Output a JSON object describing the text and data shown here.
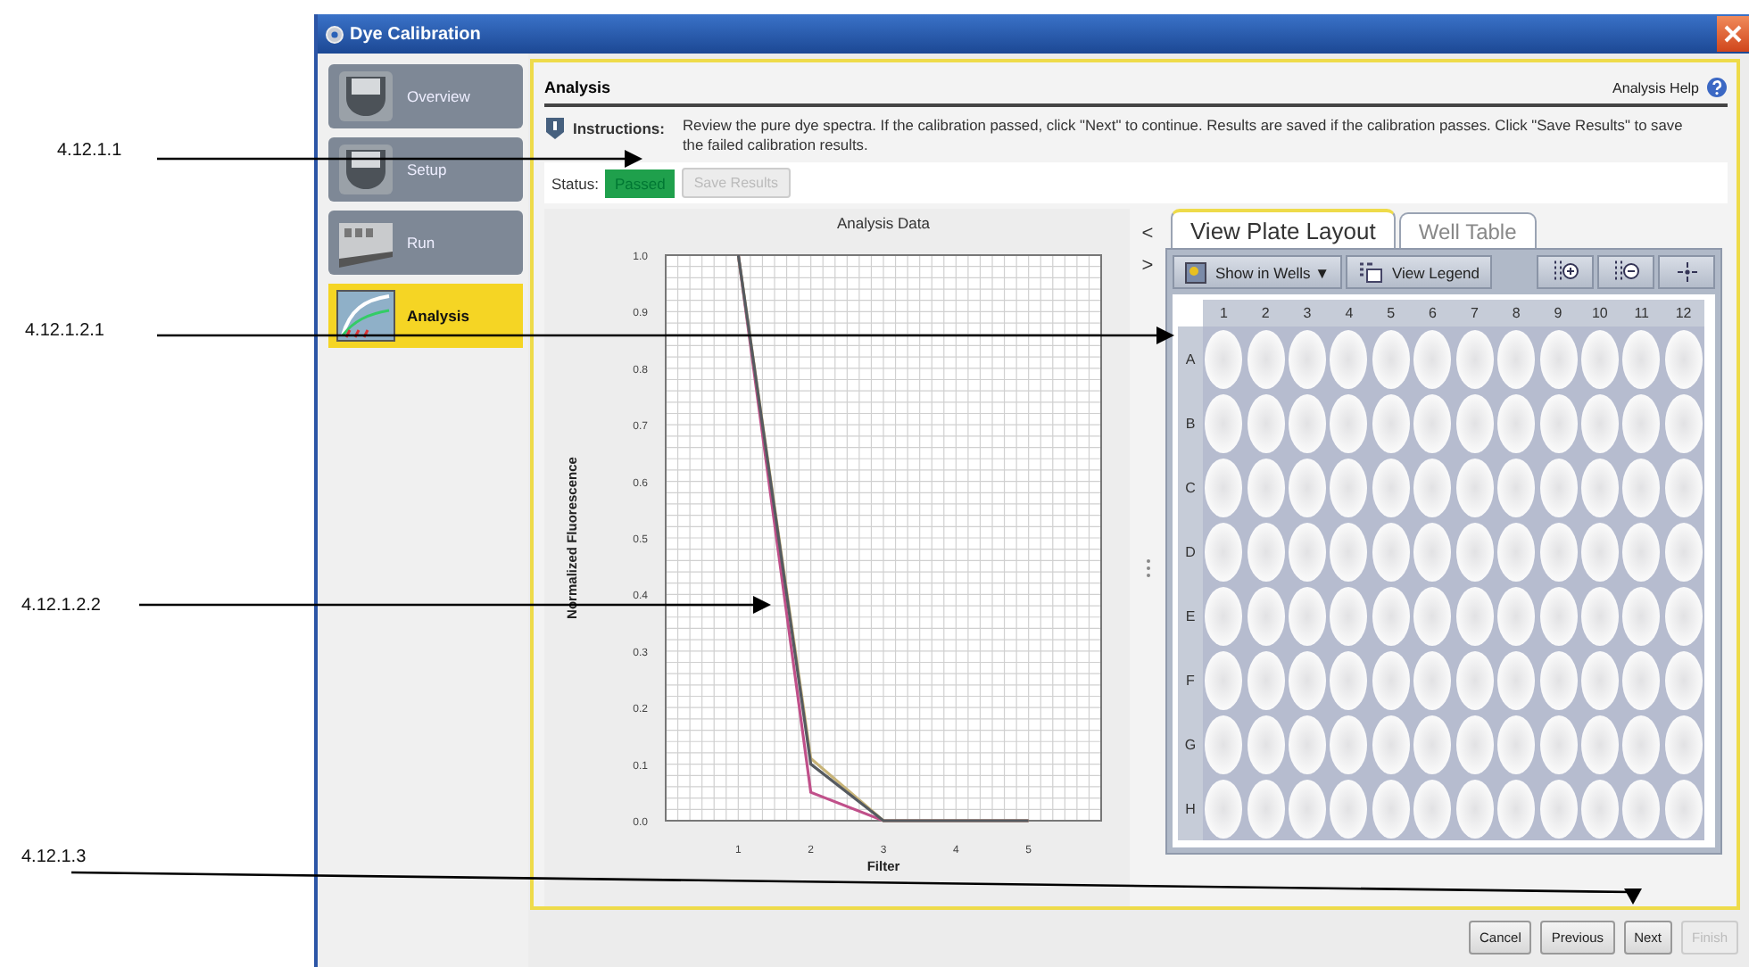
{
  "window": {
    "title": "Dye Calibration"
  },
  "sidebar": {
    "items": [
      {
        "label": "Overview",
        "selected": false
      },
      {
        "label": "Setup",
        "selected": false
      },
      {
        "label": "Run",
        "selected": false
      },
      {
        "label": "Analysis",
        "selected": true
      }
    ]
  },
  "panel": {
    "title": "Analysis",
    "help": "Analysis Help"
  },
  "instructions": {
    "label": "Instructions:",
    "text": "Review the pure dye spectra. If the calibration passed, click \"Next\" to continue. Results are saved if the calibration passes. Click \"Save Results\" to save the failed calibration results."
  },
  "status": {
    "label": "Status:",
    "value": "Passed",
    "save_button": {
      "label": "Save Results",
      "disabled": true
    }
  },
  "chart": {
    "chart_data": {
      "type": "line",
      "title": "Analysis Data",
      "xlabel": "Filter",
      "ylabel": "Normalized Fluorescence",
      "x": [
        1,
        2,
        3,
        4,
        5
      ],
      "series": [
        {
          "color": "#c0508a",
          "values": [
            1.0,
            0.05,
            0.0,
            0.0,
            0.0
          ]
        },
        {
          "color": "#c8b478",
          "values": [
            1.0,
            0.11,
            0.0,
            0.0,
            0.0
          ]
        },
        {
          "color": "#555a60",
          "values": [
            1.0,
            0.1,
            0.0,
            0.0,
            0.0
          ]
        }
      ],
      "xlim": [
        0,
        6
      ],
      "ylim": [
        0,
        1
      ],
      "grid": true,
      "xticks": [
        1,
        2,
        3,
        4,
        5
      ],
      "yticks": [
        {
          "value": 0,
          "label": "0.0"
        },
        {
          "value": 0.1,
          "label": "0.1"
        },
        {
          "value": 0.2,
          "label": "0.2"
        },
        {
          "value": 0.3,
          "label": "0.3"
        },
        {
          "value": 0.4,
          "label": "0.4"
        },
        {
          "value": 0.5,
          "label": "0.5"
        },
        {
          "value": 0.6,
          "label": "0.6"
        },
        {
          "value": 0.7,
          "label": "0.7"
        },
        {
          "value": 0.8,
          "label": "0.8"
        },
        {
          "value": 0.9,
          "label": "0.9"
        },
        {
          "value": 1,
          "label": "1.0"
        }
      ]
    }
  },
  "nav": [
    "<",
    ">"
  ],
  "tabs": [
    {
      "label": "View Plate Layout",
      "selected": true
    },
    {
      "label": "Well Table",
      "selected": false
    }
  ],
  "toolbar": [
    {
      "label": "Show in Wells ▼"
    },
    {
      "label": "View Legend"
    }
  ],
  "plate": {
    "columns": [
      "1",
      "2",
      "3",
      "4",
      "5",
      "6",
      "7",
      "8",
      "9",
      "10",
      "11",
      "12"
    ],
    "rows": [
      "A",
      "B",
      "C",
      "D",
      "E",
      "F",
      "G",
      "H"
    ]
  },
  "buttons": [
    {
      "label": "Cancel",
      "disabled": false
    },
    {
      "label": "Previous",
      "disabled": false
    },
    {
      "label": "Next",
      "disabled": false
    },
    {
      "label": "Finish",
      "disabled": true
    }
  ],
  "callouts": [
    {
      "label": "4.12.1.1"
    },
    {
      "label": "4.12.1.2.1"
    },
    {
      "label": "4.12.1.2.2"
    },
    {
      "label": "4.12.1.3"
    }
  ]
}
